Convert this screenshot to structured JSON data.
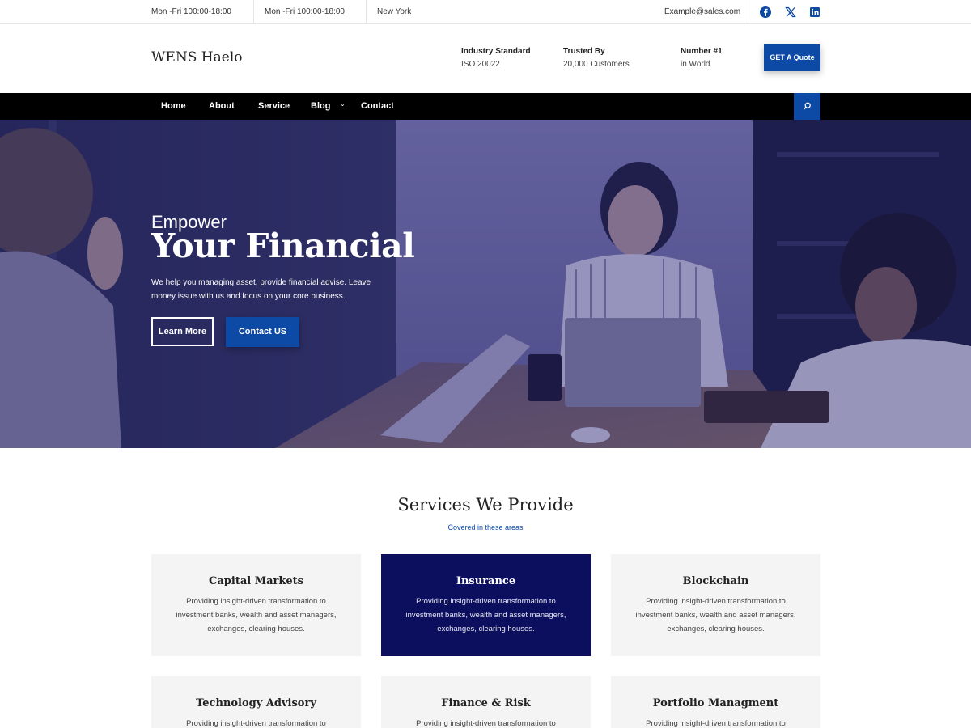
{
  "topbar": {
    "hours_1": "Mon -Fri 100:00-18:00",
    "hours_2": "Mon -Fri 100:00-18:00",
    "location": "New York",
    "email": "Example@sales.com",
    "social_icons": [
      "facebook-icon",
      "x-twitter-icon",
      "linkedin-icon"
    ]
  },
  "header": {
    "logo": "WENS Haelo",
    "info": [
      {
        "title": "Industry Standard",
        "value": "ISO 20022"
      },
      {
        "title": "Trusted By",
        "value": "20,000 Customers"
      },
      {
        "title": "Number #1",
        "value": "in World"
      }
    ],
    "cta": "GET A Quote"
  },
  "nav": {
    "items": [
      "Home",
      "About",
      "Service",
      "Blog",
      "Contact"
    ],
    "search_icon": "search-icon"
  },
  "hero": {
    "eyebrow": "Empower",
    "headline": "Your Financial",
    "description": "We help you managing asset, provide financial advise. Leave money issue with us and focus on your core business.",
    "btn_primary": "Learn More",
    "btn_secondary": "Contact US"
  },
  "services": {
    "title": "Services We Provide",
    "subtitle": "Covered in these areas",
    "cards": [
      {
        "title": "Capital Markets",
        "desc": "Providing insight-driven transformation to investment banks, wealth and asset managers, exchanges, clearing houses."
      },
      {
        "title": "Insurance",
        "desc": "Providing insight-driven transformation to investment banks, wealth and asset managers, exchanges, clearing houses."
      },
      {
        "title": "Blockchain",
        "desc": "Providing insight-driven transformation to investment banks, wealth and asset managers, exchanges, clearing houses."
      },
      {
        "title": "Technology Advisory",
        "desc": "Providing insight-driven transformation to"
      },
      {
        "title": "Finance & Risk",
        "desc": "Providing insight-driven transformation to"
      },
      {
        "title": "Portfolio Managment",
        "desc": "Providing insight-driven transformation to"
      }
    ]
  },
  "colors": {
    "accent": "#0c4aa6",
    "highlight_card": "#0b0f5e",
    "nav_bg": "#000000"
  }
}
